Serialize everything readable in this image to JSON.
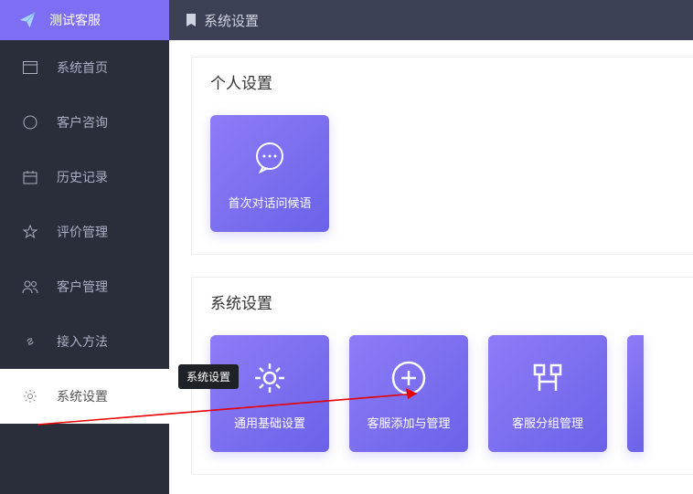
{
  "sidebar": {
    "brand": "测试客服",
    "items": [
      {
        "label": "系统首页"
      },
      {
        "label": "客户咨询"
      },
      {
        "label": "历史记录"
      },
      {
        "label": "评价管理"
      },
      {
        "label": "客户管理"
      },
      {
        "label": "接入方法"
      },
      {
        "label": "系统设置"
      }
    ]
  },
  "topbar": {
    "title": "系统设置"
  },
  "sections": [
    {
      "title": "个人设置",
      "cards": [
        {
          "label": "首次对话问候语"
        }
      ]
    },
    {
      "title": "系统设置",
      "cards": [
        {
          "label": "通用基础设置"
        },
        {
          "label": "客服添加与管理"
        },
        {
          "label": "客服分组管理"
        }
      ]
    }
  ],
  "tooltip": "系统设置"
}
